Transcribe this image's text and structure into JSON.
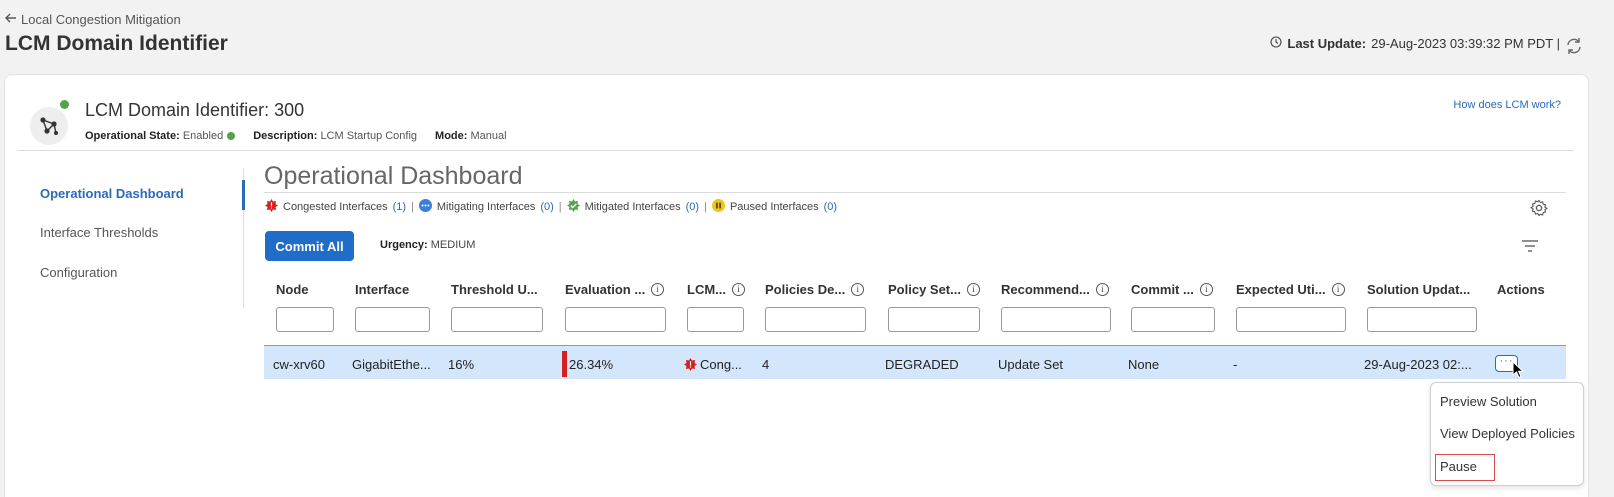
{
  "header": {
    "back_link": "Local Congestion Mitigation",
    "title": "LCM Domain Identifier",
    "last_update_label": "Last Update:",
    "last_update_value": "29-Aug-2023 03:39:32 PM PDT |"
  },
  "domain": {
    "title": "LCM Domain Identifier: 300",
    "op_state_label": "Operational State:",
    "op_state_value": "Enabled",
    "description_label": "Description:",
    "description_value": "LCM Startup Config",
    "mode_label": "Mode:",
    "mode_value": "Manual",
    "help_link": "How does LCM work?"
  },
  "sidebar": {
    "items": [
      {
        "label": "Operational Dashboard",
        "active": true
      },
      {
        "label": "Interface Thresholds",
        "active": false
      },
      {
        "label": "Configuration",
        "active": false
      }
    ]
  },
  "dashboard": {
    "title": "Operational Dashboard",
    "legend": {
      "congested_label": "Congested Interfaces",
      "congested_count": "(1)",
      "mitigating_label": "Mitigating Interfaces",
      "mitigating_count": "(0)",
      "mitigated_label": "Mitigated Interfaces",
      "mitigated_count": "(0)",
      "paused_label": "Paused Interfaces",
      "paused_count": "(0)",
      "separator": "|"
    },
    "commit_all": "Commit All",
    "urgency_label": "Urgency:",
    "urgency_value": "MEDIUM"
  },
  "table": {
    "columns": [
      "Node",
      "Interface",
      "Threshold U...",
      "Evaluation ...",
      "LCM...",
      "Policies De...",
      "Policy Set...",
      "Recommend...",
      "Commit ...",
      "Expected Uti...",
      "Solution Updat...",
      "Actions"
    ],
    "row": {
      "node": "cw-xrv60",
      "interface": "GigabitEthe...",
      "threshold": "16%",
      "evaluation": "26.34%",
      "lcm_state": "Cong...",
      "policies": "4",
      "policy_set": "DEGRADED",
      "recommendation": "Update Set",
      "commit": "None",
      "expected_util": "-",
      "solution_updated": "29-Aug-2023 02:...",
      "actions_glyph": "···"
    }
  },
  "actions_menu": {
    "items": [
      "Preview Solution",
      "View Deployed Policies",
      "Pause"
    ]
  },
  "colors": {
    "accent": "#1f6dc9",
    "link": "#2a6bb8",
    "congested": "#d6201f",
    "enabled": "#52a447",
    "row_selected": "#d4e6fb",
    "highlight_box": "#d94c4c"
  }
}
